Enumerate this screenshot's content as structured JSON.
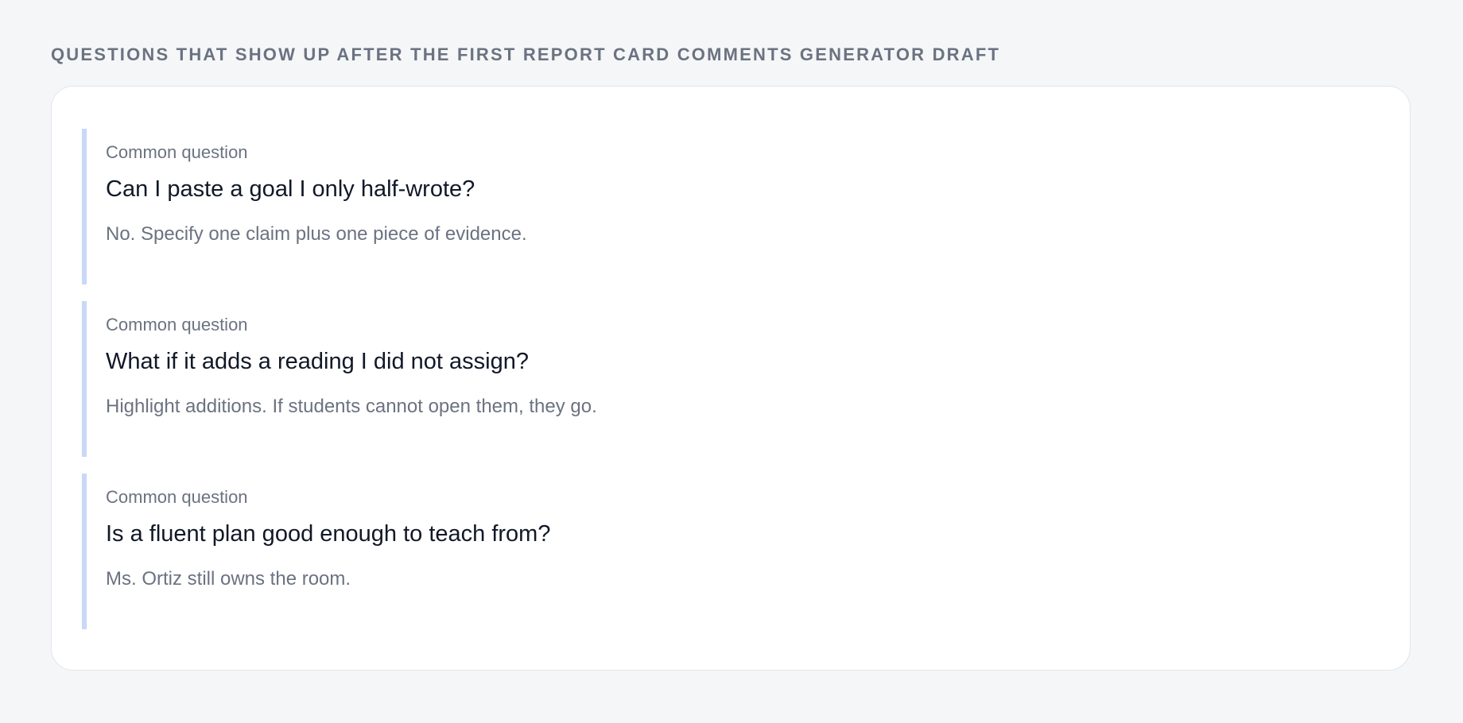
{
  "section": {
    "heading": "Questions that show up after the first report card comments generator draft"
  },
  "faq": {
    "items": [
      {
        "kicker": "Common question",
        "question": "Can I paste a goal I only half-wrote?",
        "answer": "No. Specify one claim plus one piece of evidence."
      },
      {
        "kicker": "Common question",
        "question": "What if it adds a reading I did not assign?",
        "answer": "Highlight additions. If students cannot open them, they go."
      },
      {
        "kicker": "Common question",
        "question": "Is a fluent plan good enough to teach from?",
        "answer": "Ms. Ortiz still owns the room."
      }
    ]
  },
  "colors": {
    "page_background": "#f4f6f8",
    "card_background": "#ffffff",
    "accent_bar": "#c9d8f6",
    "muted_text": "#6b7280",
    "primary_text": "#111827"
  }
}
